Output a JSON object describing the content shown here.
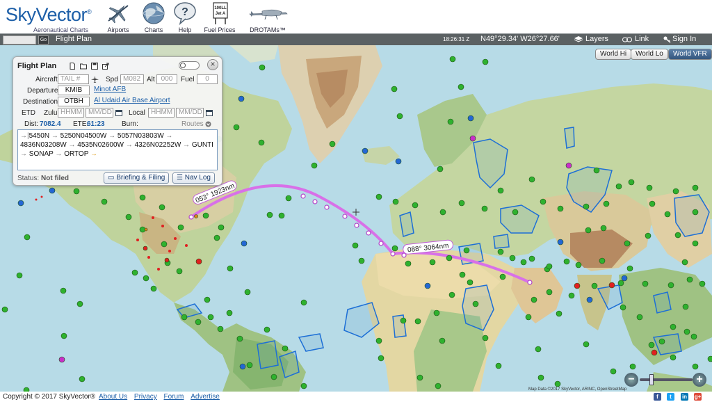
{
  "app": {
    "logo_name": "SkyVector",
    "logo_tagline": "Aeronautical Charts"
  },
  "nav": [
    {
      "label": "Airports",
      "icon": "airplane-crossed-icon"
    },
    {
      "label": "Charts",
      "icon": "globe-icon"
    },
    {
      "label": "Help",
      "icon": "help-bubble-icon"
    },
    {
      "label": "Fuel Prices",
      "icon": "fuel-sign-icon",
      "sign_line1": "100LL",
      "sign_line2": "Jet A"
    },
    {
      "label": "DROTAMs™",
      "icon": "drone-icon"
    }
  ],
  "toolbar": {
    "go_label": "Go",
    "flight_plan_label": "Flight Plan",
    "clock": "18:26:31 Z",
    "coords": "N49°29.34' W26°27.66'",
    "layers_label": "Layers",
    "link_label": "Link",
    "signin_label": "Sign In"
  },
  "world_buttons": [
    {
      "label": "World Hi",
      "active": false
    },
    {
      "label": "World Lo",
      "active": false
    },
    {
      "label": "World VFR",
      "active": true
    }
  ],
  "flight_plan": {
    "title": "Flight Plan",
    "aircraft_label": "Aircraft",
    "tail_placeholder": "TAIL #",
    "spd_label": "Spd",
    "spd_placeholder": "M082",
    "alt_label": "Alt",
    "alt_placeholder": "000",
    "fuel_label": "Fuel",
    "fuel_placeholder": "0",
    "departure_label": "Departure",
    "departure_value": "KMIB",
    "departure_name": "Minot AFB",
    "destination_label": "Destination",
    "destination_value": "OTBH",
    "destination_name": "Al Udaid Air Base Airport",
    "etd_label": "ETD",
    "zulu_label": "Zulu",
    "local_label": "Local",
    "hhmm_placeholder": "HHMM",
    "mmdd_placeholder": "MM/DD",
    "dist_label": "Dist:",
    "dist_value": "7082.4",
    "ete_label": "ETE:",
    "ete_value": "61:23",
    "burn_label": "Burn:",
    "routes_label": "Routes",
    "route_waypoints": [
      "5450N",
      "5250N04500W",
      "5057N03803W",
      "4836N03208W",
      "4535N02600W",
      "4326N02252W",
      "GUNTI",
      "SONAP",
      "ORTOP"
    ],
    "status_label": "Status:",
    "status_value": "Not filed",
    "briefing_label": "Briefing & Filing",
    "navlog_label": "Nav Log"
  },
  "map": {
    "route_labels": [
      "053° 1923nm",
      "088° 3064nm"
    ],
    "attribution": "Map Data ©2017 SkyVector, ARINC, OpenStreetMap"
  },
  "footer": {
    "copyright": "Copyright © 2017 SkyVector®",
    "links": [
      "About Us",
      "Privacy",
      "Forum",
      "Advertise"
    ]
  },
  "social": [
    "f",
    "t",
    "in",
    "g+"
  ],
  "colors": {
    "brand": "#1d5fa8",
    "route": "#d870e8",
    "ocean": "#b7dbe7",
    "toolbar": "#5b6163"
  }
}
